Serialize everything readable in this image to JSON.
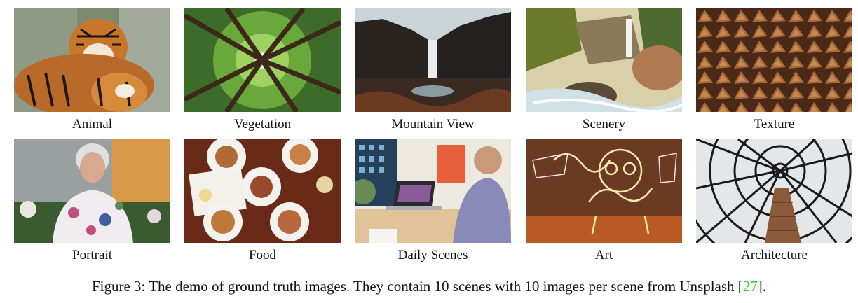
{
  "figure": {
    "scenes": [
      {
        "label": "Animal",
        "icon": "tiger-photo-icon"
      },
      {
        "label": "Vegetation",
        "icon": "forest-canopy-photo-icon"
      },
      {
        "label": "Mountain View",
        "icon": "waterfall-cliff-photo-icon"
      },
      {
        "label": "Scenery",
        "icon": "river-waterfall-photo-icon"
      },
      {
        "label": "Texture",
        "icon": "stacked-firewood-photo-icon"
      },
      {
        "label": "Portrait",
        "icon": "elderly-woman-photo-icon"
      },
      {
        "label": "Food",
        "icon": "table-food-photo-icon"
      },
      {
        "label": "Daily Scenes",
        "icon": "man-laptop-photo-icon"
      },
      {
        "label": "Art",
        "icon": "light-painting-graffiti-photo-icon"
      },
      {
        "label": "Architecture",
        "icon": "glass-dome-tower-photo-icon"
      }
    ],
    "caption_text": "Figure 3: The demo of ground truth images. They contain 10 scenes with 10 images per scene from Unsplash [",
    "caption_cite": "27",
    "caption_end": "]."
  }
}
